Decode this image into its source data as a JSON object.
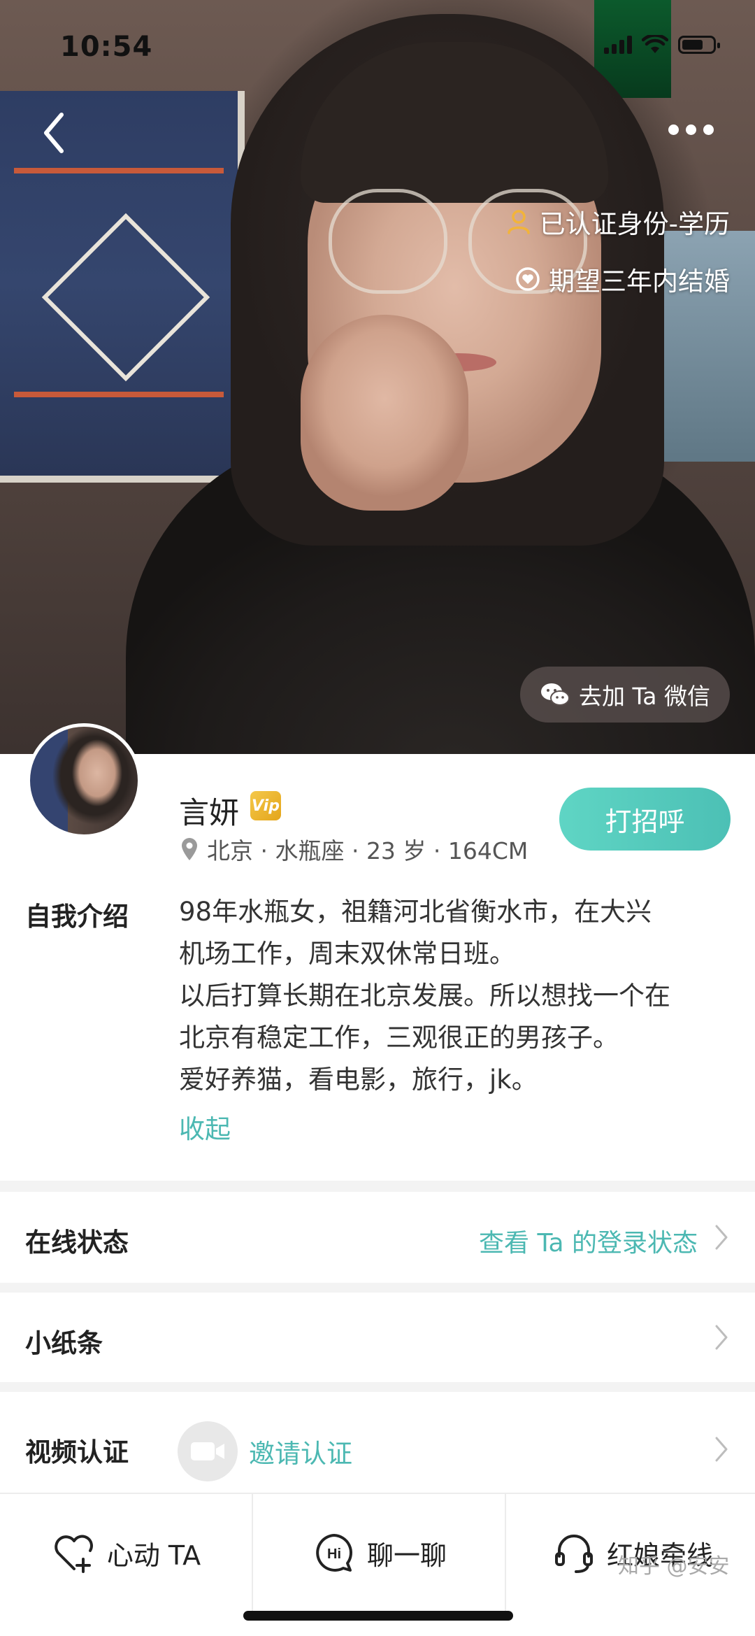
{
  "status_bar": {
    "time": "10:54"
  },
  "hero": {
    "tags": [
      "已认证身份-学历",
      "期望三年内结婚"
    ],
    "wechat_button": "去加 Ta 微信"
  },
  "profile": {
    "name": "言妍",
    "vip_badge": "Vip",
    "meta": "北京 · 水瓶座 · 23 岁 · 164CM",
    "greet_button": "打招呼",
    "intro_label": "自我介绍",
    "intro_lines": [
      "98年水瓶女，祖籍河北省衡水市，在大兴",
      "机场工作，周末双休常日班。",
      "以后打算长期在北京发展。所以想找一个在",
      "北京有稳定工作，三观很正的男孩子。",
      "爱好养猫，看电影，旅行，jk。"
    ],
    "collapse_link": "收起"
  },
  "rows": {
    "online_label": "在线状态",
    "online_value": "查看 Ta 的登录状态",
    "note_label": "小纸条",
    "video_label": "视频认证",
    "video_value": "邀请认证"
  },
  "bottom_bar": {
    "like": "心动 TA",
    "chat": "聊一聊",
    "matchmaker": "红娘牵线"
  },
  "watermark": "知乎 @安安",
  "colors": {
    "accent": "#4cb8b2",
    "button_gradient_start": "#5fd5c4",
    "button_gradient_end": "#4cc0b5"
  }
}
